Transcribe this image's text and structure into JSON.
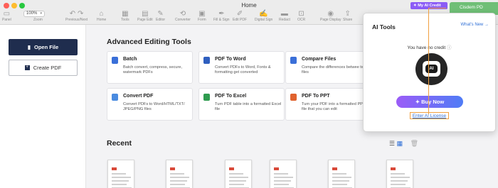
{
  "window": {
    "title": "Home"
  },
  "toolbar": {
    "zoom_value": "100%",
    "items": [
      {
        "label": "Panel",
        "icon": "panel-icon"
      },
      {
        "label": "Zoom",
        "icon": "zoom-icon"
      },
      {
        "label": "Previous/Next",
        "icon": "arrow-icon"
      },
      {
        "label": "Home",
        "icon": "home-icon"
      },
      {
        "label": "Tools",
        "icon": "tools-icon"
      },
      {
        "label": "Page Edit",
        "icon": "page-edit-icon"
      },
      {
        "label": "Editor",
        "icon": "editor-icon"
      },
      {
        "label": "Converter",
        "icon": "converter-icon"
      },
      {
        "label": "Form",
        "icon": "form-icon"
      },
      {
        "label": "Fill & Sign",
        "icon": "fill-sign-icon"
      },
      {
        "label": "Edit PDF",
        "icon": "edit-pdf-icon"
      },
      {
        "label": "Digital Sign",
        "icon": "digital-sign-icon"
      },
      {
        "label": "Redact",
        "icon": "redact-icon"
      },
      {
        "label": "OCR",
        "icon": "ocr-icon"
      },
      {
        "label": "Page Display",
        "icon": "page-display-icon"
      },
      {
        "label": "Share",
        "icon": "share-icon"
      }
    ]
  },
  "credit_button": "My AI Credit",
  "tab": {
    "label": "Cisdem PD"
  },
  "sidebar": {
    "open_file": "Open File",
    "create_pdf": "Create PDF"
  },
  "main": {
    "advanced_heading": "Advanced Editing Tools",
    "cards": [
      {
        "title": "Batch",
        "desc": "Batch convert, compress, secure, watermark PDFs",
        "color": "#3a6fd8"
      },
      {
        "title": "PDF To Word",
        "desc": "Convert PDFs to Word, Fonts & formatting get converted",
        "color": "#2f5fbf"
      },
      {
        "title": "Compare Files",
        "desc": "Compare the differences betwee two files",
        "color": "#3a6fd8"
      },
      {
        "title": "Convert PDF",
        "desc": "Convert PDFs to Word/HTML/TXT/ JPEG/PNG files",
        "color": "#4a8be0"
      },
      {
        "title": "PDF To Excel",
        "desc": "Turn PDF table into a formatted Excel file",
        "color": "#2e9b4f"
      },
      {
        "title": "PDF To PPT",
        "desc": "Turn your PDF into a formatted PPT file that you can edit",
        "color": "#e0622e"
      }
    ],
    "recent_heading": "Recent"
  },
  "ai_panel": {
    "title": "AI Tools",
    "whats_new": "What's New →",
    "no_credit": "You have no credit",
    "avatar_text": "AI",
    "buy_now": "Buy Now",
    "enter_license": "Enter AI License"
  }
}
